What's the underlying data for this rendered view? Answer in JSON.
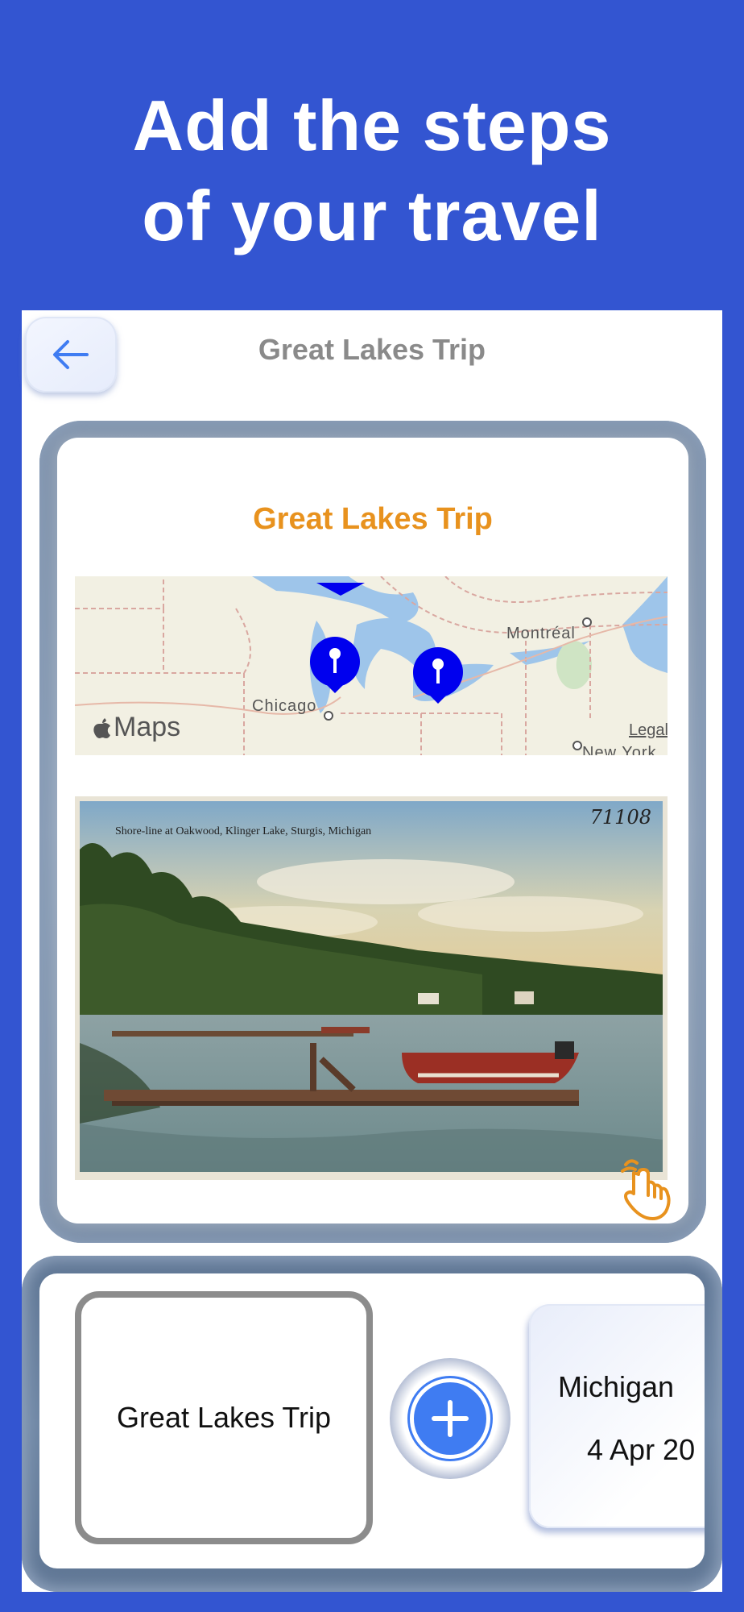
{
  "headline": {
    "line1": "Add the steps",
    "line2": "of your travel"
  },
  "nav": {
    "back_icon": "arrow-left-icon",
    "title": "Great Lakes Trip"
  },
  "trip_card": {
    "title": "Great Lakes Trip",
    "map": {
      "labels": {
        "city1": "Chicago",
        "city2": "Montréal",
        "city3": "New York"
      },
      "brand": "Maps",
      "legal": "Legal",
      "pin_color": "#0000ee"
    },
    "photo": {
      "caption": "Shore-line at Oakwood, Klinger Lake, Sturgis, Michigan",
      "number": "71108"
    },
    "tap_icon": "hand-tap-icon"
  },
  "steps": {
    "current": {
      "label": "Great Lakes Trip"
    },
    "add_icon": "plus-icon",
    "next": {
      "name": "Michigan",
      "date": "4 Apr 20"
    }
  },
  "colors": {
    "background": "#3355d1",
    "accent_title": "#e8921e",
    "add_button": "#3f7cf2"
  }
}
